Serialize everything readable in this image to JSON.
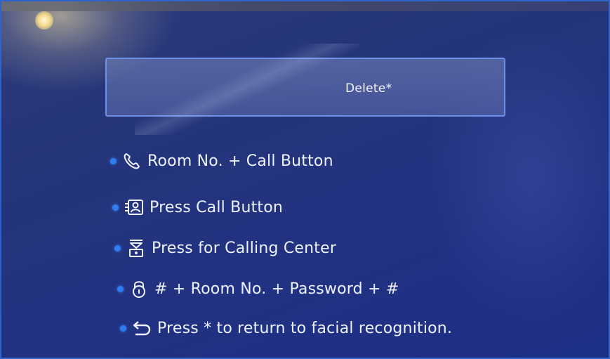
{
  "input": {
    "text": "Delete*"
  },
  "instructions": [
    {
      "icon": "phone-icon",
      "text": "Room No. + Call Button"
    },
    {
      "icon": "contact-card-icon",
      "text": "Press Call Button"
    },
    {
      "icon": "calling-center-icon",
      "text": "Press for Calling Center"
    },
    {
      "icon": "lock-icon",
      "text": "# + Room No. + Password + #"
    },
    {
      "icon": "return-arrow-icon",
      "text": "Press * to return to facial recognition."
    }
  ],
  "colors": {
    "background": "#223281",
    "box_border": "#6d8fe6",
    "bullet": "#2f7df0",
    "text": "#eef2ff"
  }
}
